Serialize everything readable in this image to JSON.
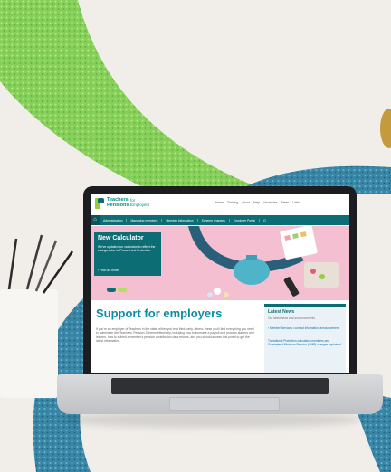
{
  "site": {
    "logo_line1": "Teachers'",
    "logo_line2": "Pensions",
    "logo_sub_1": "for",
    "logo_sub_2": "Employers",
    "topnav": [
      "Home",
      "Training",
      "About",
      "Help",
      "Vacancies",
      "Press",
      "Links"
    ],
    "mainnav": [
      "Administration",
      "Managing members",
      "Member information",
      "Scheme changes",
      "Employer Portal",
      "Q"
    ]
  },
  "hero": {
    "title": "New Calculator",
    "body": "We've updated our calculator to reflect the changes due to Phased and Protection",
    "link": "› Find out more"
  },
  "main": {
    "heading": "Support for employers",
    "paragraph": "If you're an employer of Teachers in the state, either you're a third-party, others; these you'll find everything you need to administer the Teachers' Pension Scheme effectively, including how to increase a payroll and process starters and leavers, how to submit a member's pension contribution data returns, and you should access this portal to get the latest information."
  },
  "news": {
    "heading": "Latest News",
    "subheading": "Our latest news and announcements",
    "items": [
      "› Member Services • contact information announcement",
      "Transitional Protection calculation members and Guaranteed Minimum Pension (GMP) changes explained"
    ]
  },
  "colors": {
    "brand_teal": "#0c6e74",
    "heading_blue": "#0b8da8",
    "hero_pink": "#f4bfd0",
    "glitter_green": "#7ec85a",
    "glitter_blue": "#3f86a5"
  }
}
